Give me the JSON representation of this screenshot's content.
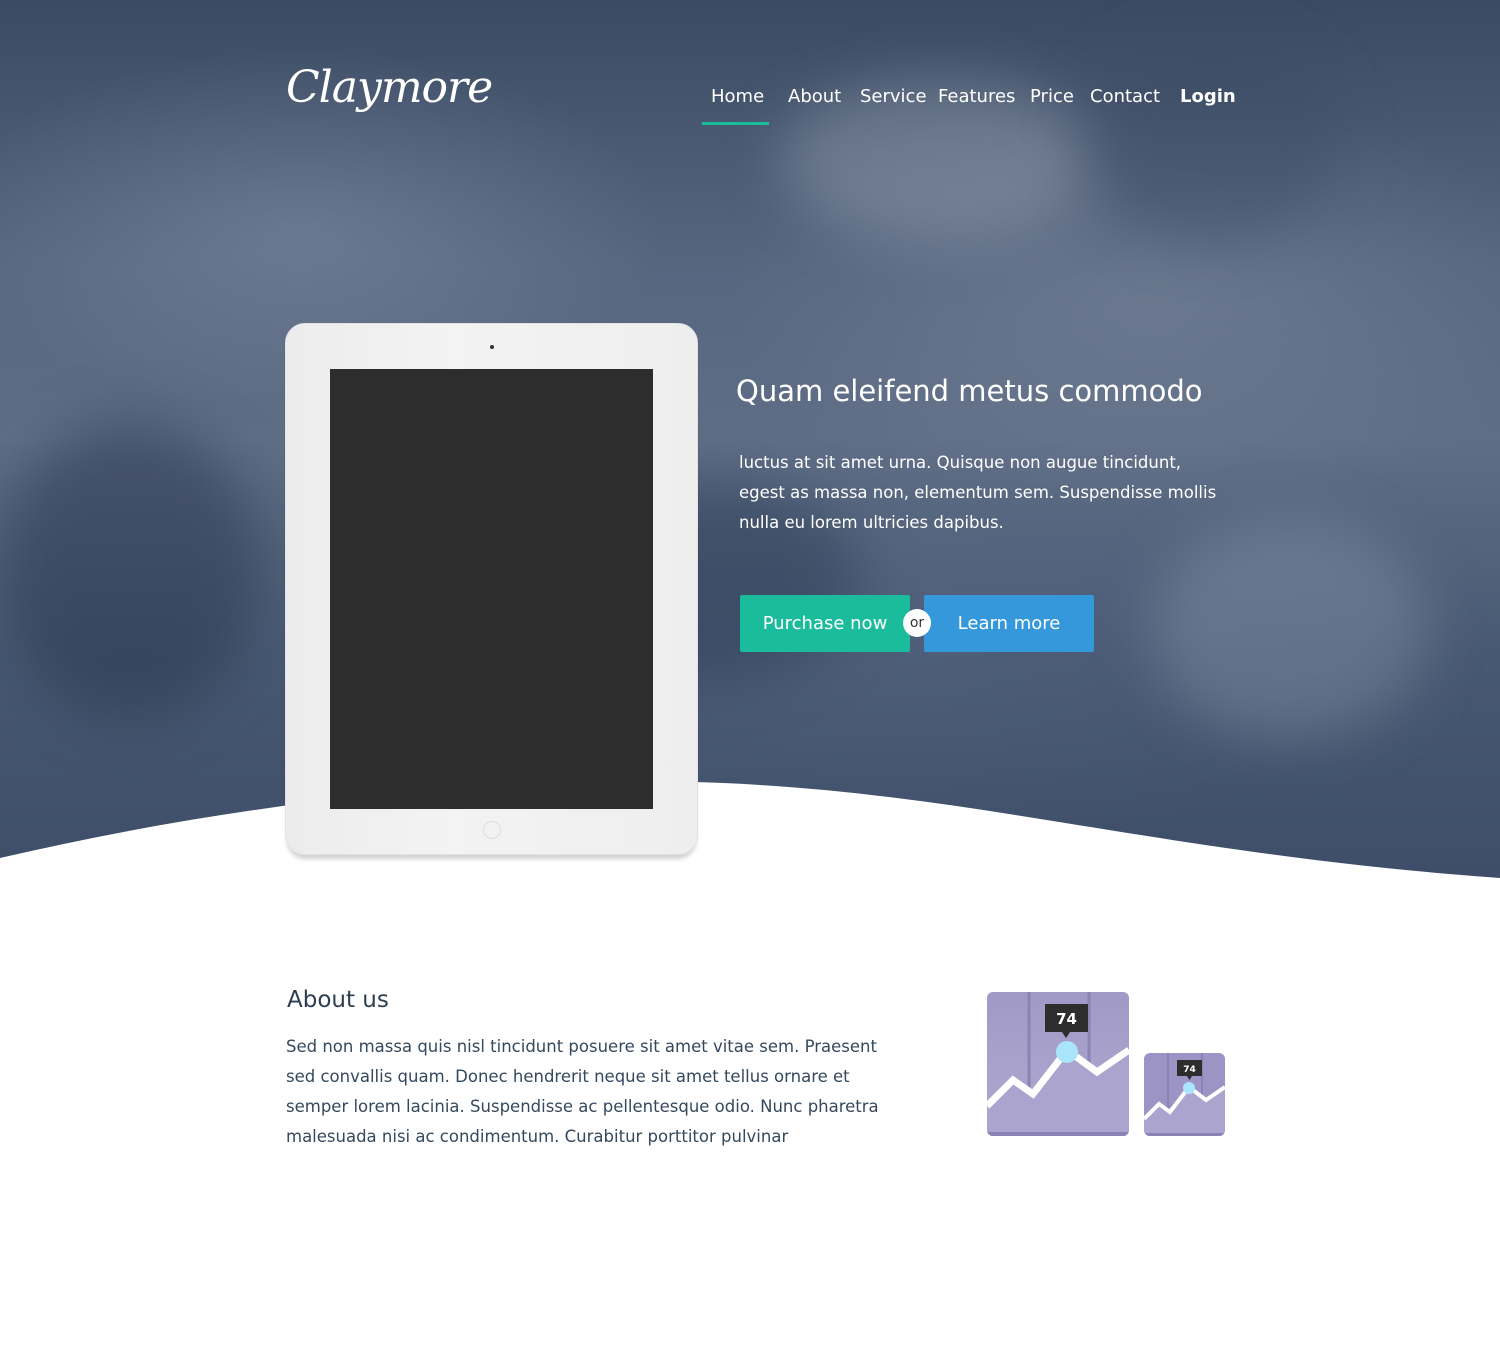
{
  "brand": {
    "logo_text": "Claymore"
  },
  "nav": {
    "items": [
      "Home",
      "About",
      "Service",
      "Features",
      "Price",
      "Contact"
    ],
    "active": "Home",
    "login": "Login"
  },
  "hero": {
    "title": "Quam eleifend metus commodo",
    "body": "luctus at sit amet urna. Quisque non augue tincidunt, egest as massa non, elementum sem. Suspendisse mollis nulla eu lorem ultricies dapibus.",
    "primary_button": "Purchase now",
    "separator": "or",
    "secondary_button": "Learn more"
  },
  "about": {
    "title": "About us",
    "body": "Sed non massa quis nisl tincidunt posuere sit amet vitae sem. Praesent sed convallis quam. Donec hendrerit neque sit amet tellus ornare et semper lorem lacinia. Suspendisse ac pellentesque odio. Nunc pharetra malesuada nisi ac condimentum. Curabitur porttitor pulvinar"
  },
  "icons": {
    "large_value": "74",
    "small_value": "74"
  },
  "colors": {
    "accent_green": "#1abc9c",
    "accent_blue": "#3498db",
    "icon_purple": "#9b94c4",
    "text_dark": "#2c3e50"
  }
}
